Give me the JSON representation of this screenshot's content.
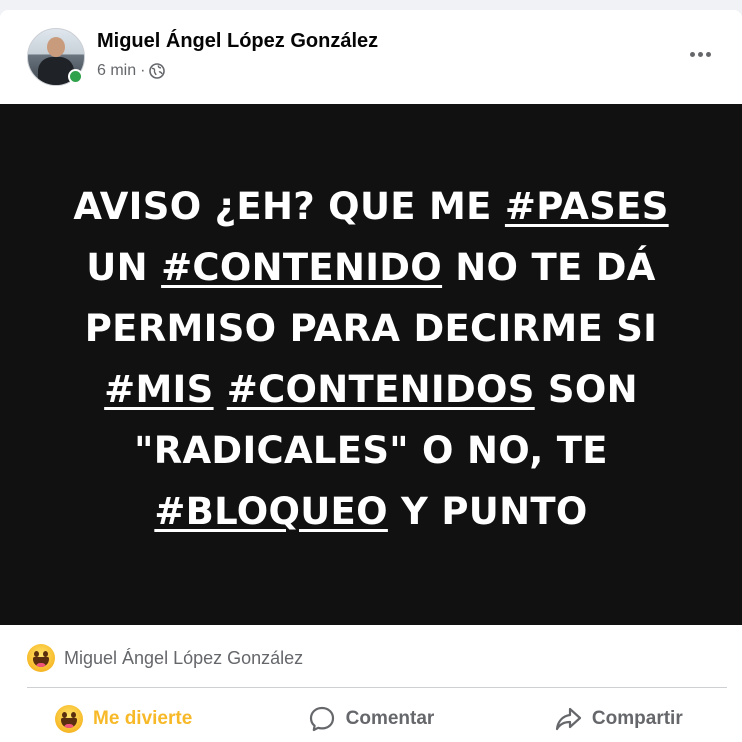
{
  "post": {
    "author": "Miguel Ángel López González",
    "time": "6 min",
    "separator": "·",
    "audience_icon": "globe-icon",
    "menu_icon": "more-options-icon"
  },
  "image_text": {
    "lines": [
      [
        {
          "t": "AVISO ¿EH? QUE ME ",
          "tag": false
        },
        {
          "t": "#PASES",
          "tag": true
        }
      ],
      [
        {
          "t": "UN ",
          "tag": false
        },
        {
          "t": "#CONTENIDO",
          "tag": true
        },
        {
          "t": " NO TE DÁ",
          "tag": false
        }
      ],
      [
        {
          "t": "PERMISO PARA DECIRME SI",
          "tag": false
        }
      ],
      [
        {
          "t": "#MIS",
          "tag": true
        },
        {
          "t": " ",
          "tag": false
        },
        {
          "t": "#CONTENIDOS",
          "tag": true
        },
        {
          "t": " SON",
          "tag": false
        }
      ],
      [
        {
          "t": "\"RADICALES\" O NO, TE",
          "tag": false
        }
      ],
      [
        {
          "t": "#BLOQUEO",
          "tag": true
        },
        {
          "t": " Y PUNTO",
          "tag": false
        }
      ]
    ]
  },
  "reactions": {
    "icon": "haha-emoji-icon",
    "name": "Miguel Ángel López González"
  },
  "actions": {
    "react_label": "Me divierte",
    "comment_label": "Comentar",
    "share_label": "Compartir"
  },
  "colors": {
    "background": "#f0f2f5",
    "card": "#ffffff",
    "media_bg": "#111111",
    "reaction_active": "#f7b928",
    "secondary_text": "#65676b",
    "online": "#31a24c"
  }
}
